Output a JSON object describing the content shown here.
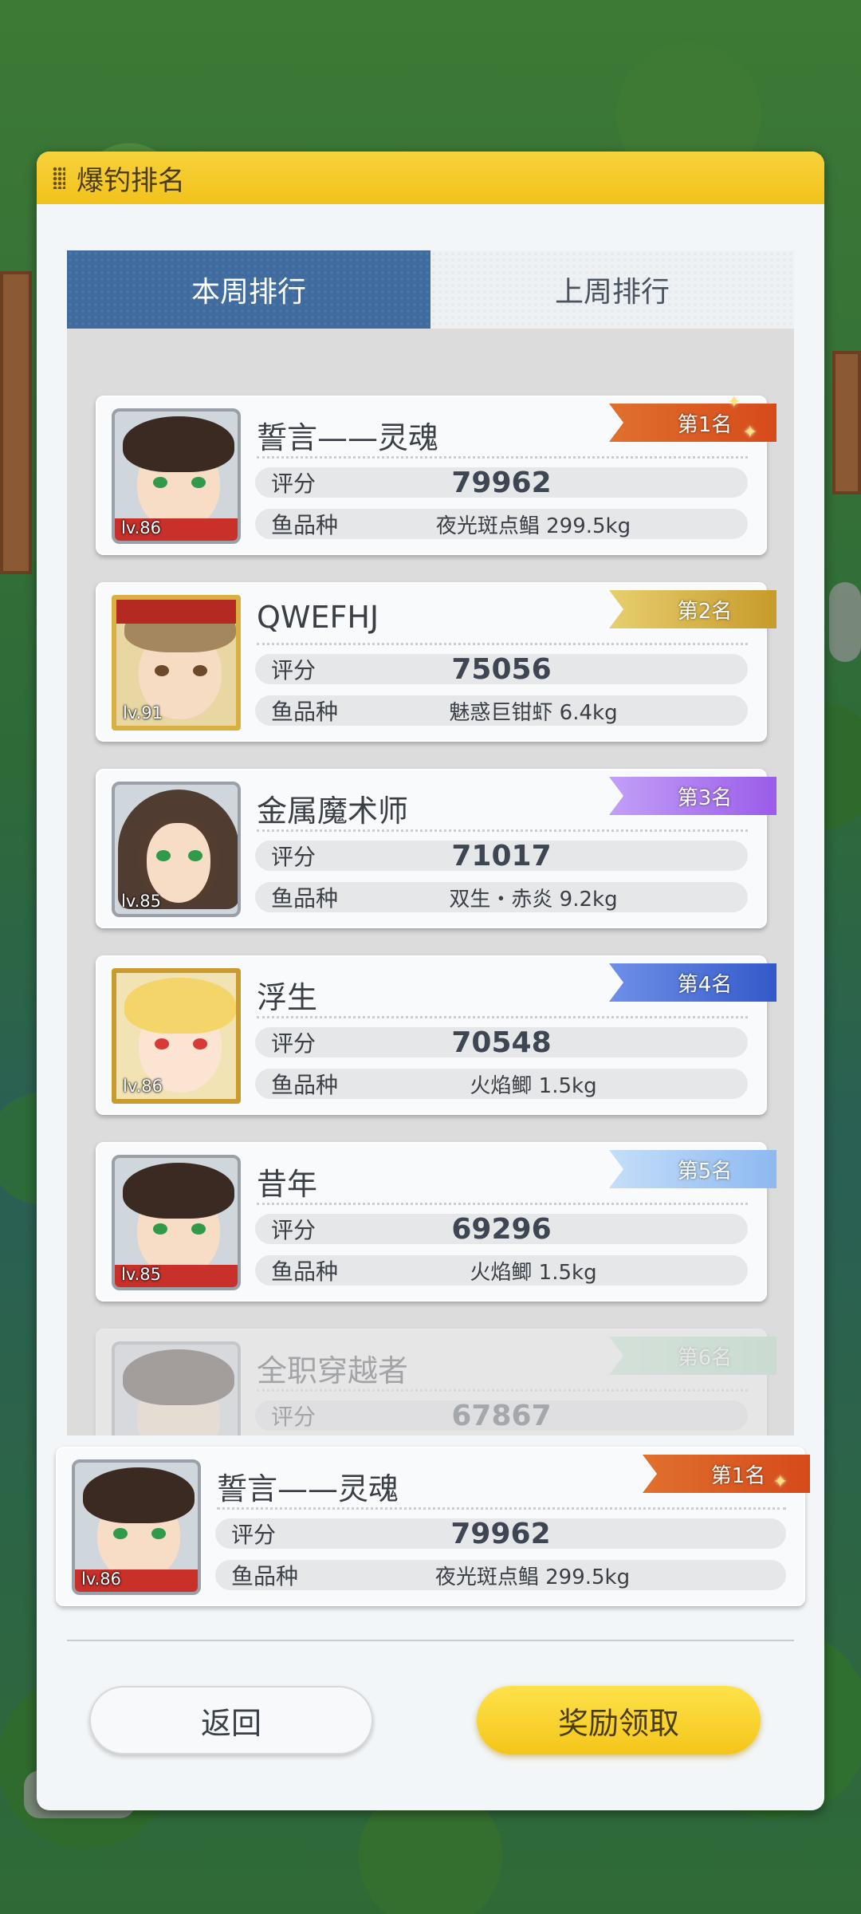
{
  "dialog": {
    "title": "爆钓排名"
  },
  "tabs": [
    {
      "label": "本周排行",
      "active": true
    },
    {
      "label": "上周排行",
      "active": false
    }
  ],
  "labels": {
    "score": "评分",
    "fish": "鱼品种"
  },
  "rankings": [
    {
      "rank_label": "第1名",
      "name": "誓言——灵魂",
      "level": "lv.86",
      "score": "79962",
      "fish": "夜光斑点鲳 299.5kg",
      "avatar": "boy-avatar-icon"
    },
    {
      "rank_label": "第2名",
      "name": "QWEFHJ",
      "level": "lv.91",
      "score": "75056",
      "fish": "魅惑巨钳虾 6.4kg",
      "avatar": "girl-gold-frame-avatar-icon"
    },
    {
      "rank_label": "第3名",
      "name": "金属魔术师",
      "level": "lv.85",
      "score": "71017",
      "fish": "双生・赤炎 9.2kg",
      "avatar": "girl-avatar-icon"
    },
    {
      "rank_label": "第4名",
      "name": "浮生",
      "level": "lv.86",
      "score": "70548",
      "fish": "火焰鲫 1.5kg",
      "avatar": "blonde-gold-frame-avatar-icon"
    },
    {
      "rank_label": "第5名",
      "name": "昔年",
      "level": "lv.85",
      "score": "69296",
      "fish": "火焰鲫 1.5kg",
      "avatar": "boy-avatar-icon"
    },
    {
      "rank_label": "第6名",
      "name": "全职穿越者",
      "level": "",
      "score": "67867",
      "fish": "",
      "avatar": "boy-avatar-icon"
    }
  ],
  "self": {
    "rank_label": "第1名",
    "name": "誓言——灵魂",
    "level": "lv.86",
    "score": "79962",
    "fish": "夜光斑点鲳 299.5kg"
  },
  "buttons": {
    "back": "返回",
    "claim": "奖励领取"
  },
  "colors": {
    "header": "#f2c21c",
    "tab_active": "#3f6b9e",
    "claim_button": "#f4c51a"
  }
}
